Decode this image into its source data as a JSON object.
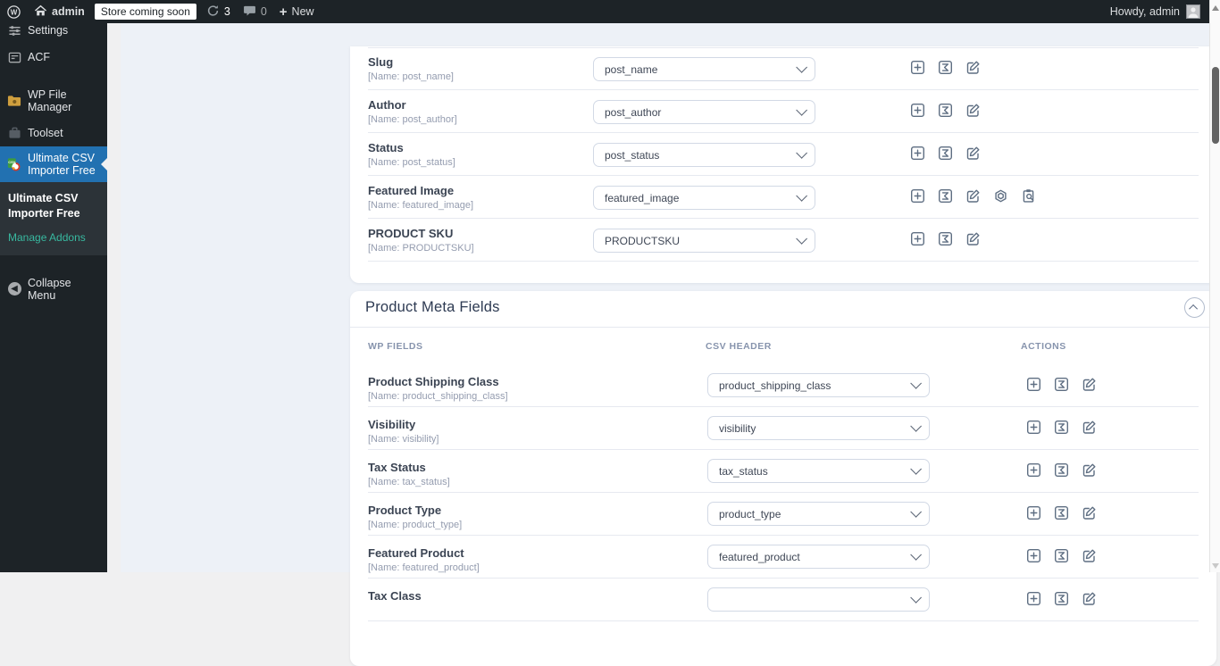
{
  "admin_bar": {
    "site_name": "admin",
    "badge": "Store coming soon",
    "updates_count": "3",
    "comments_count": "0",
    "new_label": "New",
    "howdy": "Howdy, admin"
  },
  "sidebar": {
    "items": [
      {
        "label": "Settings",
        "icon": "settings-icon"
      },
      {
        "label": "ACF",
        "icon": "acf-icon"
      },
      {
        "label": "WP File Manager",
        "icon": "folder-icon"
      },
      {
        "label": "Toolset",
        "icon": "toolset-icon"
      },
      {
        "label": "Ultimate CSV Importer Free",
        "icon": "csv-importer-logo",
        "active": true
      }
    ],
    "submenu": {
      "current": "Ultimate CSV Importer Free",
      "link": "Manage Addons"
    },
    "collapse_label": "Collapse Menu"
  },
  "fields_card": {
    "rows": [
      {
        "label": "Slug",
        "name": "[Name: post_name]",
        "value": "post_name"
      },
      {
        "label": "Author",
        "name": "[Name: post_author]",
        "value": "post_author"
      },
      {
        "label": "Status",
        "name": "[Name: post_status]",
        "value": "post_status"
      },
      {
        "label": "Featured Image",
        "name": "[Name: featured_image]",
        "value": "featured_image",
        "extra": true
      },
      {
        "label": "PRODUCT SKU",
        "name": "[Name: PRODUCTSKU]",
        "value": "PRODUCTSKU"
      }
    ]
  },
  "meta_card": {
    "title": "Product Meta Fields",
    "headers": [
      "WP FIELDS",
      "CSV HEADER",
      "ACTIONS"
    ],
    "rows": [
      {
        "label": "Product Shipping Class",
        "name": "[Name: product_shipping_class]",
        "value": "product_shipping_class"
      },
      {
        "label": "Visibility",
        "name": "[Name: visibility]",
        "value": "visibility"
      },
      {
        "label": "Tax Status",
        "name": "[Name: tax_status]",
        "value": "tax_status"
      },
      {
        "label": "Product Type",
        "name": "[Name: product_type]",
        "value": "product_type"
      },
      {
        "label": "Featured Product",
        "name": "[Name: featured_product]",
        "value": "featured_product"
      },
      {
        "label": "Tax Class",
        "name": "",
        "value": ""
      }
    ]
  },
  "icons": {
    "add": "plus-in-square",
    "formula": "sigma-in-square",
    "edit": "pencil-in-square",
    "openai": "openai-swirl",
    "media_search": "clipboard-magnifier",
    "dropdown": "chevron-down",
    "collapse_section": "chevron-up-circle"
  },
  "colors": {
    "admin_bar_bg": "#1d2327",
    "sidebar_bg": "#1d2327",
    "submenu_bg": "#2c3338",
    "active_menu_blue": "#2271b1",
    "manage_addons_teal": "#38b9a0",
    "plugin_area_bg": "#edf1f7",
    "card_bg": "#ffffff",
    "icon_slate": "#5e6e82",
    "label_dark": "#3b4453",
    "muted_gray": "#949caf"
  }
}
